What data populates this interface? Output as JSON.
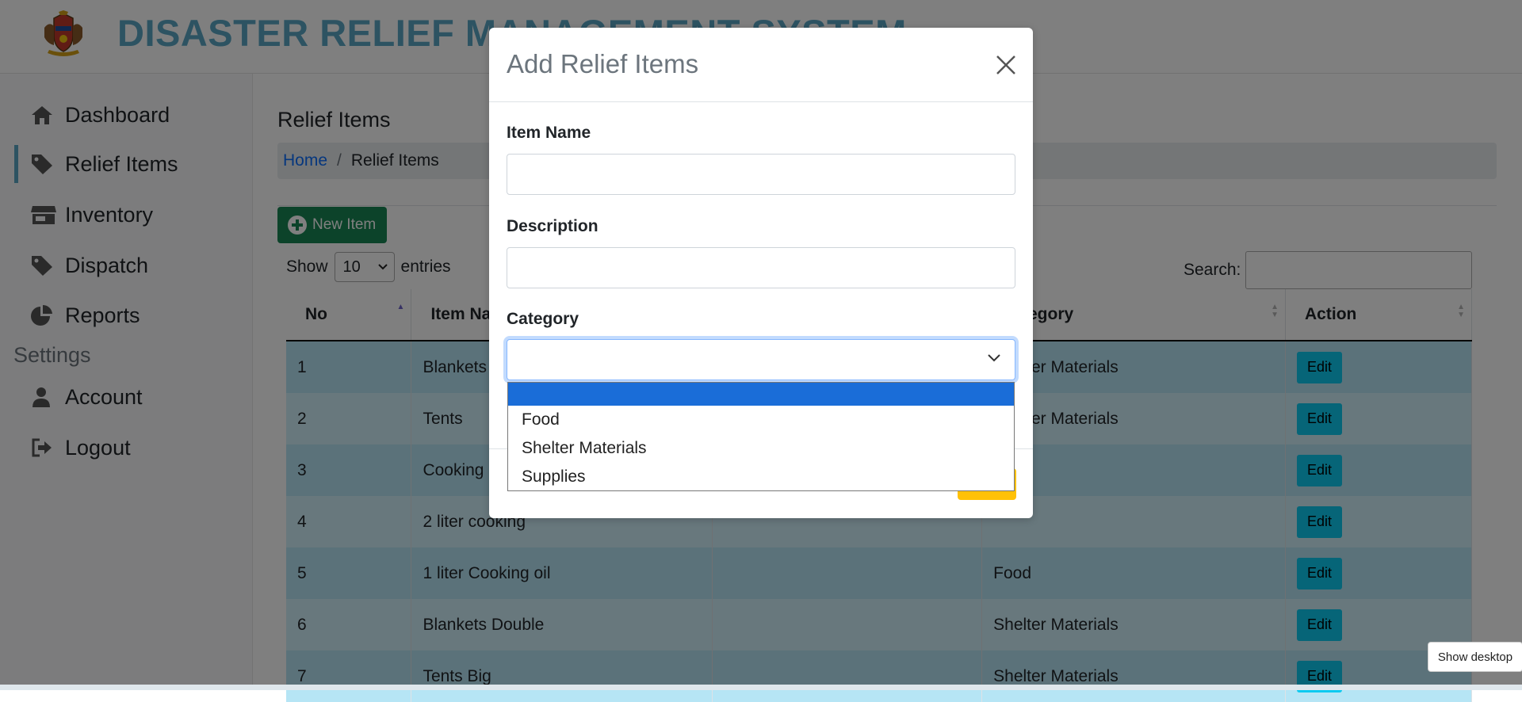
{
  "app": {
    "title": "DISASTER RELIEF MANAGEMENT SYSTEM"
  },
  "sidebar": {
    "items": [
      {
        "label": "Dashboard",
        "icon": "home-icon"
      },
      {
        "label": "Relief Items",
        "icon": "tag-icon"
      },
      {
        "label": "Inventory",
        "icon": "store-icon"
      },
      {
        "label": "Dispatch",
        "icon": "tag-icon"
      },
      {
        "label": "Reports",
        "icon": "pie-chart-icon"
      }
    ],
    "settings_label": "Settings",
    "settings_items": [
      {
        "label": "Account",
        "icon": "user-icon"
      },
      {
        "label": "Logout",
        "icon": "logout-icon"
      }
    ]
  },
  "main": {
    "heading": "Relief Items",
    "breadcrumb": {
      "home": "Home",
      "current": "Relief Items",
      "separator": "/"
    },
    "new_item_label": "New Item",
    "show_label": "Show",
    "entries_value": "10",
    "entries_label": "entries",
    "search_label": "Search:"
  },
  "table": {
    "headers": [
      "No",
      "Item Name",
      "",
      "Category",
      "Action"
    ],
    "rows": [
      {
        "no": "1",
        "name": "Blankets",
        "desc": "",
        "category": "Shelter Materials",
        "action": "Edit"
      },
      {
        "no": "2",
        "name": "Tents",
        "desc": "",
        "category": "Shelter Materials",
        "action": "Edit"
      },
      {
        "no": "3",
        "name": "Cooking",
        "desc": "",
        "category": "",
        "action": "Edit"
      },
      {
        "no": "4",
        "name": "2 liter cooking",
        "desc": "",
        "category": "",
        "action": "Edit"
      },
      {
        "no": "5",
        "name": "1 liter Cooking oil",
        "desc": "",
        "category": "Food",
        "action": "Edit"
      },
      {
        "no": "6",
        "name": "Blankets Double",
        "desc": "",
        "category": "Shelter Materials",
        "action": "Edit"
      },
      {
        "no": "7",
        "name": "Tents Big",
        "desc": "",
        "category": "Shelter Materials",
        "action": "Edit"
      }
    ]
  },
  "modal": {
    "title": "Add Relief Items",
    "item_name_label": "Item Name",
    "item_name_value": "",
    "description_label": "Description",
    "description_value": "",
    "category_label": "Category",
    "category_value": "",
    "category_options": [
      "",
      "Food",
      "Shelter Materials",
      "Supplies"
    ]
  },
  "system": {
    "show_desktop": "Show desktop"
  },
  "colors": {
    "title_blue": "#5aa7c5",
    "success_green": "#198754",
    "info_cyan": "#0dcaf0",
    "row_odd": "#b6e5f5",
    "row_even": "#d1f0fa",
    "dropdown_highlight": "#1a6dd8",
    "warning_yellow": "#ffc107"
  }
}
